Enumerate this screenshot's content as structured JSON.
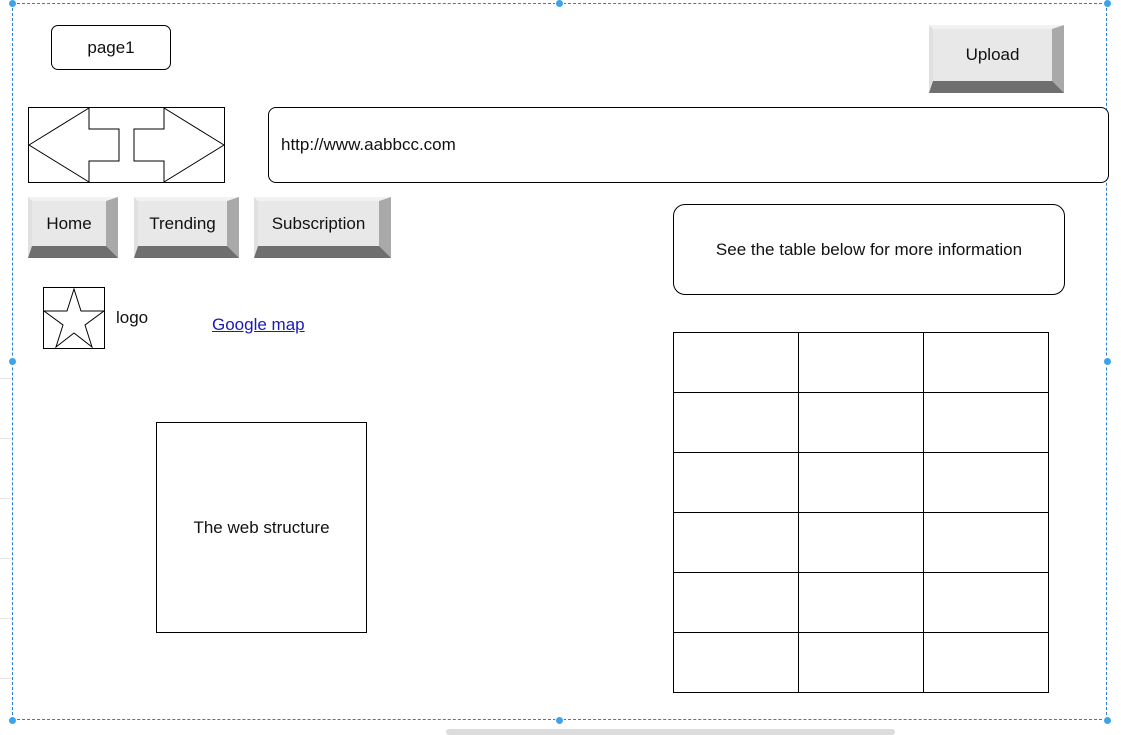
{
  "page": {
    "name": "page1"
  },
  "toolbar": {
    "upload_label": "Upload"
  },
  "nav": {
    "back_icon": "arrow-left-icon",
    "forward_icon": "arrow-right-icon",
    "url": "http://www.aabbcc.com",
    "buttons": [
      {
        "label": "Home"
      },
      {
        "label": "Trending"
      },
      {
        "label": "Subscription"
      }
    ]
  },
  "brand": {
    "logo_icon": "star-icon",
    "logo_label": "logo"
  },
  "links": {
    "map": "Google map"
  },
  "info": {
    "text": "See the table below for more information"
  },
  "content": {
    "structure_label": "The web structure"
  },
  "table": {
    "rows": [
      [
        "",
        "",
        ""
      ],
      [
        "",
        "",
        ""
      ],
      [
        "",
        "",
        ""
      ],
      [
        "",
        "",
        ""
      ],
      [
        "",
        "",
        ""
      ],
      [
        "",
        "",
        ""
      ]
    ]
  },
  "colors": {
    "selection": "#2b7fd1",
    "handle": "#3da3e8",
    "link": "#1a1ab8",
    "button_face": "#e8e8e8",
    "button_shadow": "#6f6f6f"
  }
}
